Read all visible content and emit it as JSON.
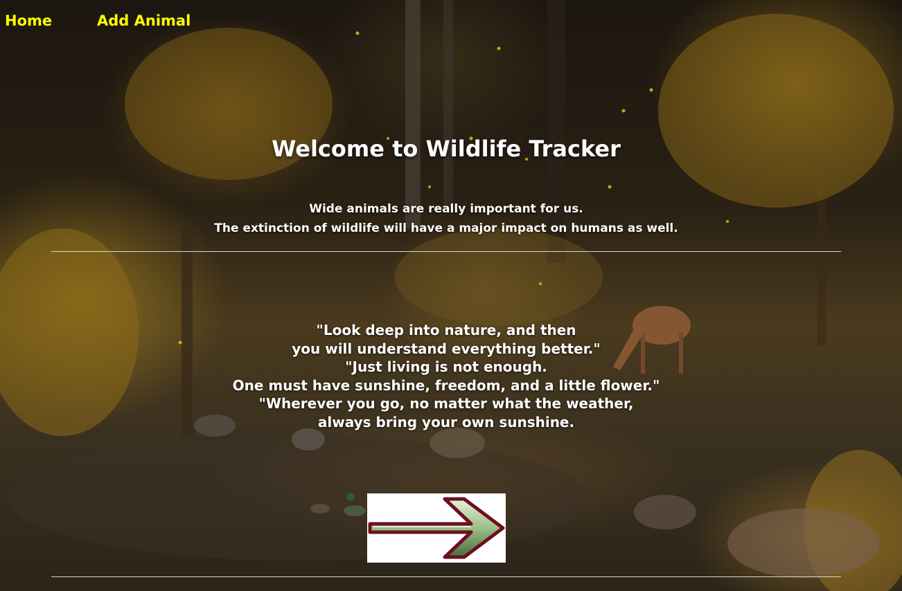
{
  "nav": {
    "home_label": "Home",
    "add_animal_label": "Add Animal"
  },
  "header": {
    "title": "Welcome to Wildlife Tracker"
  },
  "intro": {
    "line1": "Wide animals are really important for us.",
    "line2": "The extinction of wildlife will have a major impact on humans as well."
  },
  "quotes": [
    "\"Look deep into nature, and then",
    "you will understand everything better.\"",
    "\"Just living is not enough.",
    "One must have sunshine, freedom, and a little flower.\"",
    "\"Wherever you go, no matter what the weather,",
    "always bring your own sunshine."
  ],
  "icons": {
    "next": "right-arrow-icon"
  },
  "colors": {
    "nav_link": "#ffff00",
    "text": "#ffffff",
    "arrow_outline": "#6b1020",
    "arrow_fill": "#9bbf86"
  }
}
